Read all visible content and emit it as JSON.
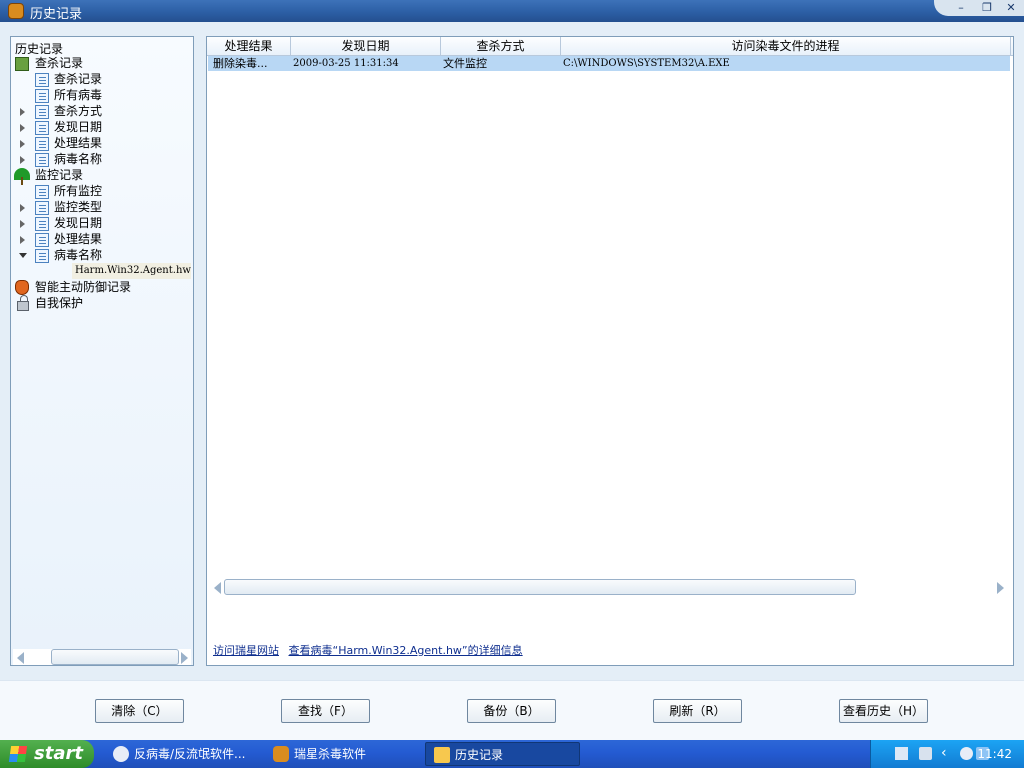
{
  "window": {
    "title": "历史记录"
  },
  "tree": {
    "root": "历史记录",
    "scan_records": {
      "label": "查杀记录",
      "children": [
        "查杀记录",
        "所有病毒",
        "查杀方式",
        "发现日期",
        "处理结果",
        "病毒名称"
      ]
    },
    "monitor_records": {
      "label": "监控记录",
      "children": [
        "所有监控",
        "监控类型",
        "发现日期",
        "处理结果",
        "病毒名称"
      ]
    },
    "selected_virus": "Harm.Win32.Agent.hw",
    "defense_records": "智能主动防御记录",
    "self_protection": "自我保护"
  },
  "list": {
    "headers": [
      "处理结果",
      "发现日期",
      "查杀方式",
      "访问染毒文件的进程"
    ],
    "rows": [
      {
        "result": "删除染毒...",
        "date": "2009-03-25 11:31:34",
        "method": "文件监控",
        "process": "C:\\WINDOWS\\SYSTEM32\\A.EXE"
      }
    ]
  },
  "links": {
    "visit_site": "访问瑞星网站",
    "virus_info": "查看病毒“Harm.Win32.Agent.hw”的详细信息"
  },
  "buttons": {
    "clear": "清除（C）",
    "find": "查找（F）",
    "backup": "备份（B）",
    "refresh": "刷新（R）",
    "history": "查看历史（H）"
  },
  "taskbar": {
    "start": "start",
    "items": [
      "反病毒/反流氓软件...",
      "瑞星杀毒软件",
      "历史记录"
    ],
    "time": "11:42"
  },
  "colors": {
    "titlebar": "#2c5fa5",
    "selection": "#b8d7f4",
    "link": "#0f2f8f"
  }
}
